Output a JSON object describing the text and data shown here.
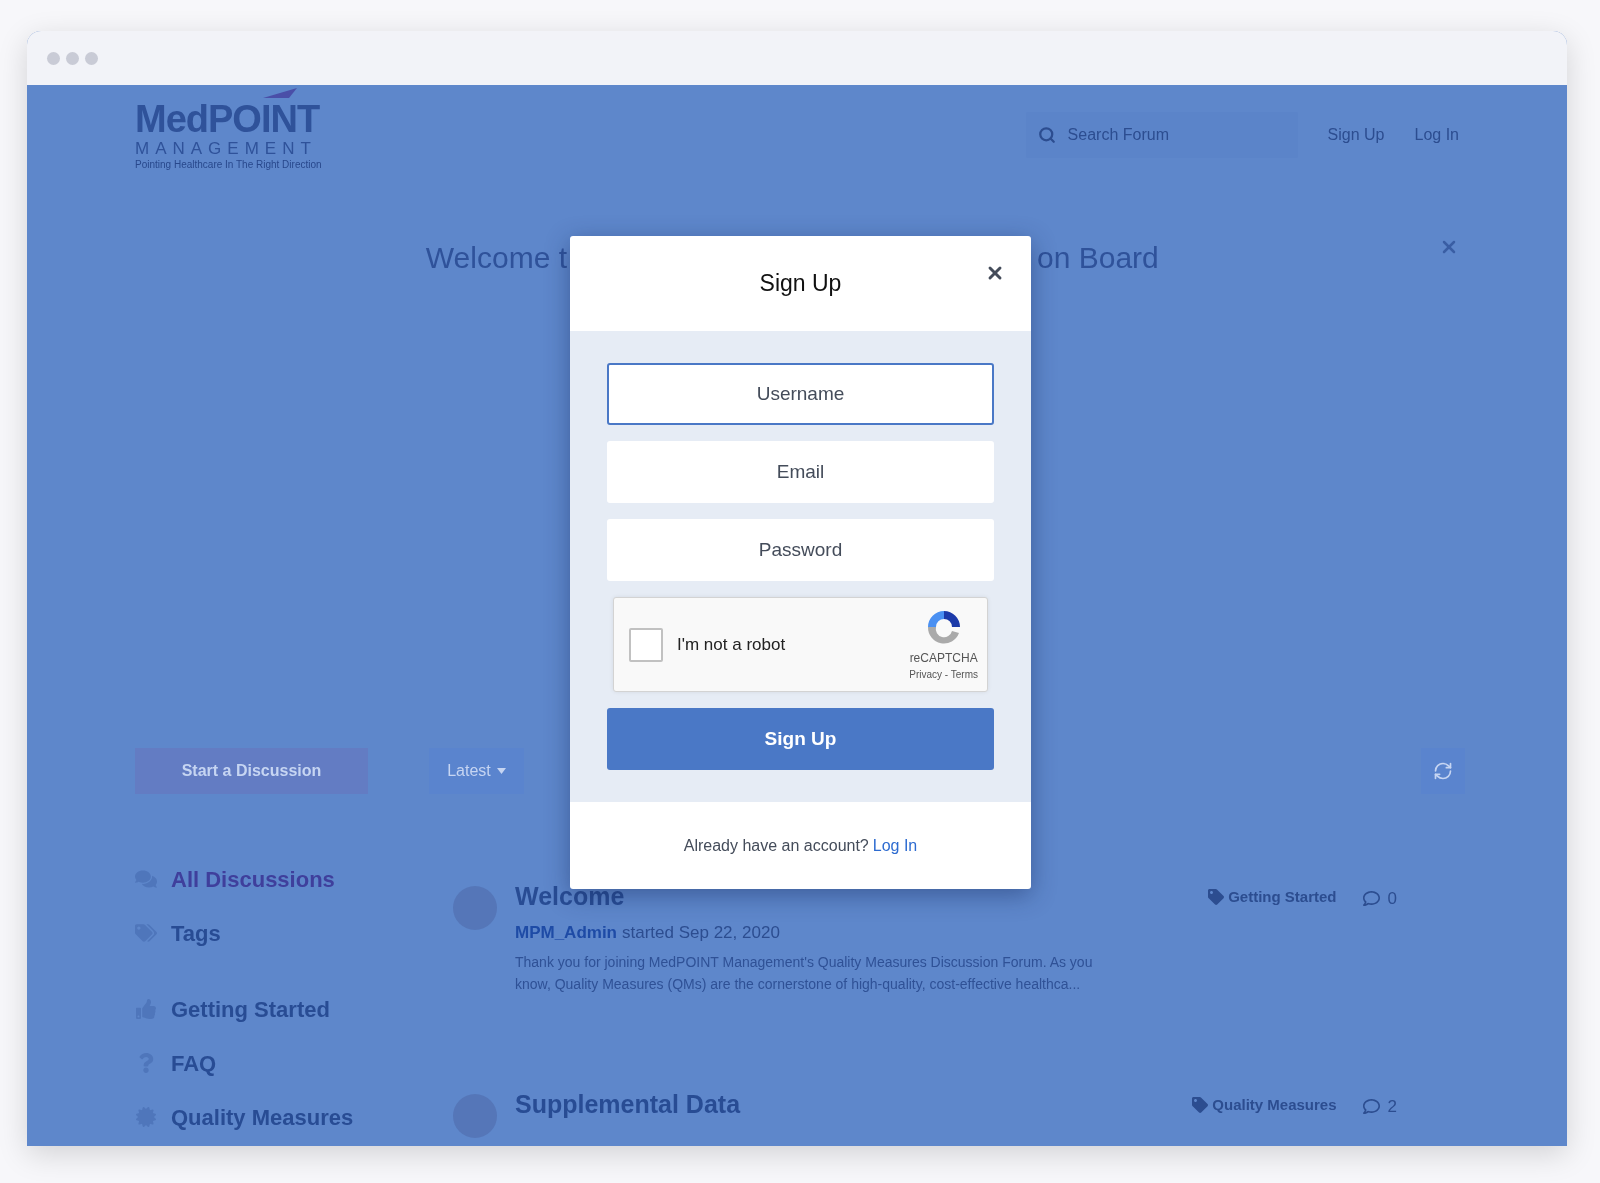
{
  "header": {
    "logo": {
      "name": "MedPOINT",
      "sub": "MANAGEMENT",
      "tagline": "Pointing Healthcare In The Right Direction"
    },
    "search": {
      "placeholder": "Search Forum"
    },
    "links": [
      "Sign Up",
      "Log In"
    ]
  },
  "hero": {
    "title_left": "Welcome t",
    "title_right": "on Board"
  },
  "toolbar": {
    "start_button": "Start a Discussion",
    "sort": "Latest"
  },
  "sidebar": {
    "nav": [
      {
        "label": "All Discussions",
        "selected": true
      },
      {
        "label": "Tags",
        "selected": false
      }
    ],
    "tags": [
      {
        "label": "Getting Started"
      },
      {
        "label": "FAQ"
      },
      {
        "label": "Quality Measures"
      }
    ]
  },
  "discussions": [
    {
      "title": "Welcome",
      "author": "MPM_Admin",
      "meta": "started Sep 22, 2020",
      "excerpt": "Thank you for joining MedPOINT Management's Quality Measures Discussion Forum. As you know, Quality Measures (QMs) are the cornerstone of high-quality, cost-effective healthca...",
      "tag": "Getting Started",
      "replies": "0"
    },
    {
      "title": "Supplemental Data",
      "tag": "Quality Measures",
      "replies": "2"
    }
  ],
  "modal": {
    "title": "Sign Up",
    "fields": [
      {
        "placeholder": "Username",
        "focused": true
      },
      {
        "placeholder": "Email",
        "focused": false
      },
      {
        "placeholder": "Password",
        "focused": false
      }
    ],
    "captcha": {
      "label": "I'm not a robot",
      "checked": false,
      "brand": "reCAPTCHA",
      "links": "Privacy - Terms"
    },
    "submit": "Sign Up",
    "footer": {
      "text": "Already have an account?",
      "link": "Log In"
    }
  }
}
